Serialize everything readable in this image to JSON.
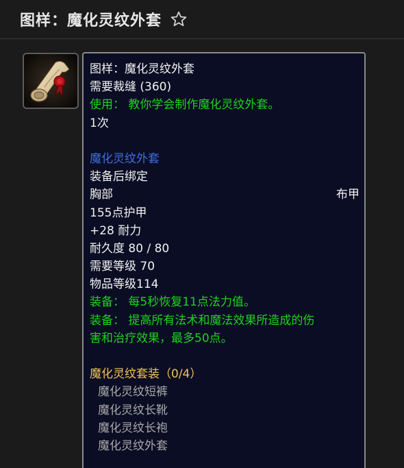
{
  "header": {
    "title": "图样：魔化灵纹外套"
  },
  "tooltip": {
    "name": "图样：魔化灵纹外套",
    "requires_skill": "需要裁缝 (360)",
    "use_text": "使用： 教你学会制作魔化灵纹外套。",
    "charges": "1次",
    "item_name": "魔化灵纹外套",
    "bind": "装备后绑定",
    "slot": "胸部",
    "armor_type": "布甲",
    "armor": "155点护甲",
    "stamina": "+28 耐力",
    "durability": "耐久度 80 / 80",
    "required_level": "需要等级 70",
    "item_level": "物品等级114",
    "equip1": "装备： 每5秒恢复11点法力值。",
    "equip2_line1": "装备： 提高所有法术和魔法效果所造成的伤",
    "equip2_line2": "害和治疗效果，最多50点。",
    "set_name": "魔化灵纹套装（0/4）",
    "set_items": [
      "魔化灵纹短裤",
      "魔化灵纹长靴",
      "魔化灵纹长袍",
      "魔化灵纹外套"
    ]
  },
  "colors": {
    "green": "#1ed31e",
    "blue": "#3d6fe0",
    "gold": "#f0c25a",
    "gray": "#a8a8a8",
    "tooltip_bg": "#0b0d24"
  },
  "icons": {
    "favorite": "star-outline-icon",
    "item": "scroll-pattern-icon"
  }
}
